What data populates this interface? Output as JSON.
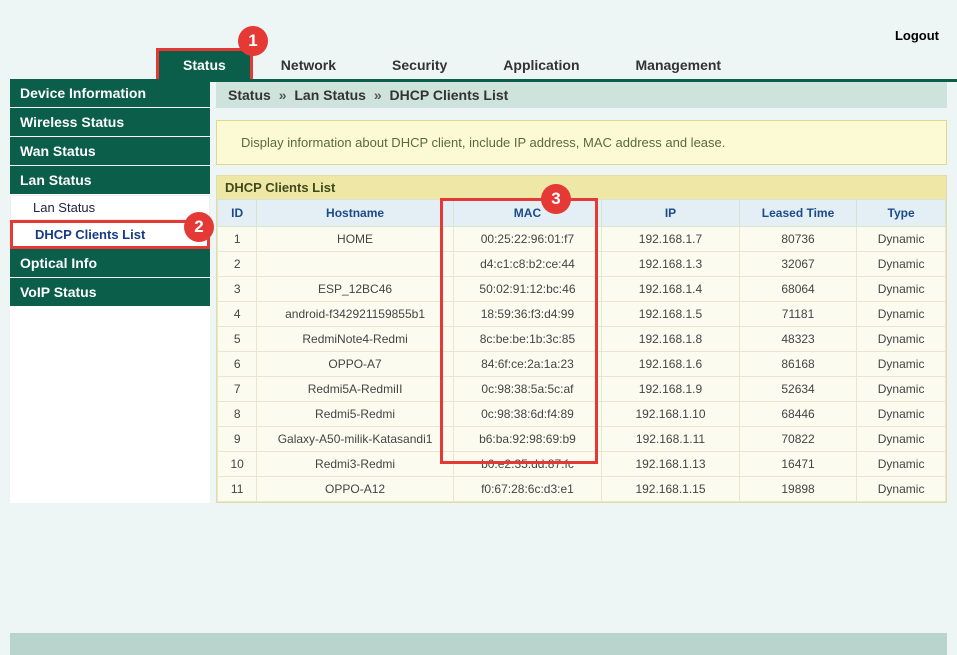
{
  "header": {
    "logout": "Logout",
    "tabs": {
      "status": "Status",
      "network": "Network",
      "security": "Security",
      "application": "Application",
      "management": "Management"
    }
  },
  "badges": {
    "one": "1",
    "two": "2",
    "three": "3"
  },
  "sidebar": {
    "device_info": "Device Information",
    "wireless_status": "Wireless Status",
    "wan_status": "Wan Status",
    "lan_status": "Lan Status",
    "lan_status_sub": "Lan Status",
    "dhcp_clients_list": "DHCP Clients List",
    "optical_info": "Optical Info",
    "voip_status": "VoIP Status"
  },
  "breadcrumb": {
    "p0": "Status",
    "p1": "Lan Status",
    "p2": "DHCP Clients List",
    "sep": "»"
  },
  "description": "Display information about DHCP client, include IP address, MAC address and lease.",
  "table": {
    "title": "DHCP Clients List",
    "headers": {
      "id": "ID",
      "hostname": "Hostname",
      "mac": "MAC",
      "ip": "IP",
      "leased": "Leased Time",
      "type": "Type"
    },
    "rows": [
      {
        "id": "1",
        "hostname": "HOME",
        "mac": "00:25:22:96:01:f7",
        "ip": "192.168.1.7",
        "leased": "80736",
        "type": "Dynamic"
      },
      {
        "id": "2",
        "hostname": "",
        "mac": "d4:c1:c8:b2:ce:44",
        "ip": "192.168.1.3",
        "leased": "32067",
        "type": "Dynamic"
      },
      {
        "id": "3",
        "hostname": "ESP_12BC46",
        "mac": "50:02:91:12:bc:46",
        "ip": "192.168.1.4",
        "leased": "68064",
        "type": "Dynamic"
      },
      {
        "id": "4",
        "hostname": "android-f342921159855b1",
        "mac": "18:59:36:f3:d4:99",
        "ip": "192.168.1.5",
        "leased": "71181",
        "type": "Dynamic"
      },
      {
        "id": "5",
        "hostname": "RedmiNote4-Redmi",
        "mac": "8c:be:be:1b:3c:85",
        "ip": "192.168.1.8",
        "leased": "48323",
        "type": "Dynamic"
      },
      {
        "id": "6",
        "hostname": "OPPO-A7",
        "mac": "84:6f:ce:2a:1a:23",
        "ip": "192.168.1.6",
        "leased": "86168",
        "type": "Dynamic"
      },
      {
        "id": "7",
        "hostname": "Redmi5A-RedmiII",
        "mac": "0c:98:38:5a:5c:af",
        "ip": "192.168.1.9",
        "leased": "52634",
        "type": "Dynamic"
      },
      {
        "id": "8",
        "hostname": "Redmi5-Redmi",
        "mac": "0c:98:38:6d:f4:89",
        "ip": "192.168.1.10",
        "leased": "68446",
        "type": "Dynamic"
      },
      {
        "id": "9",
        "hostname": "Galaxy-A50-milik-Katasandi1",
        "mac": "b6:ba:92:98:69:b9",
        "ip": "192.168.1.11",
        "leased": "70822",
        "type": "Dynamic"
      },
      {
        "id": "10",
        "hostname": "Redmi3-Redmi",
        "mac": "b0:e2:35:dd:87:fc",
        "ip": "192.168.1.13",
        "leased": "16471",
        "type": "Dynamic"
      },
      {
        "id": "11",
        "hostname": "OPPO-A12",
        "mac": "f0:67:28:6c:d3:e1",
        "ip": "192.168.1.15",
        "leased": "19898",
        "type": "Dynamic"
      }
    ]
  }
}
